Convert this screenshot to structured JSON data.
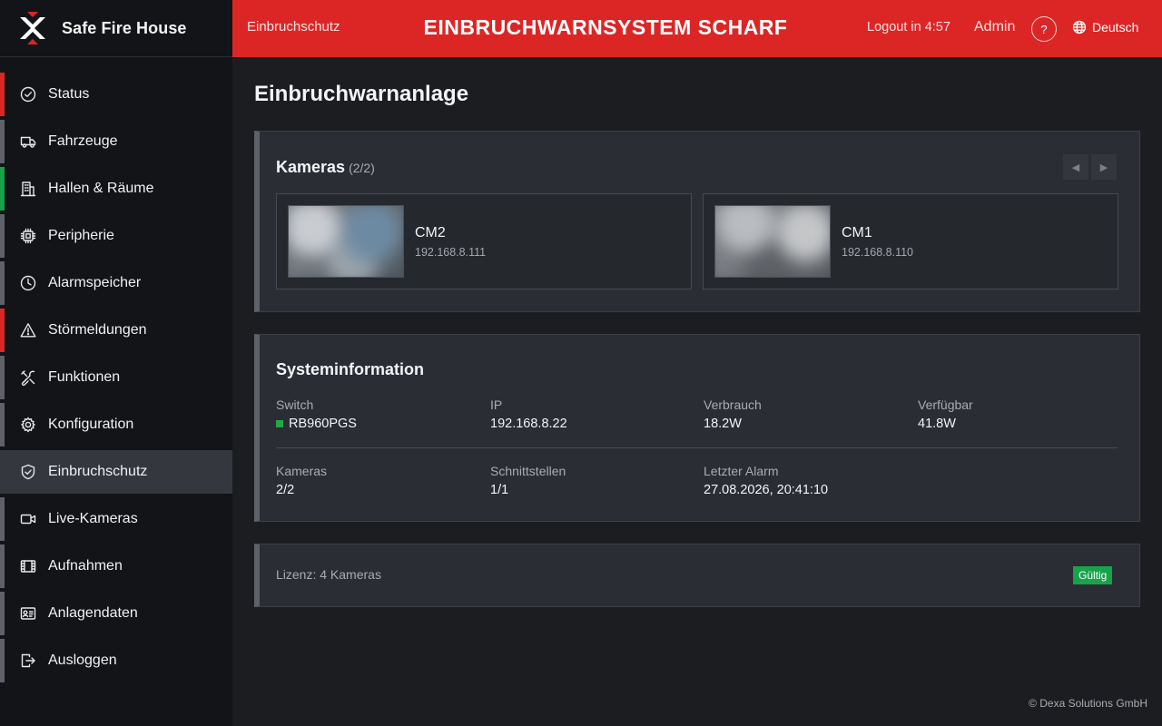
{
  "app": {
    "name": "Safe Fire House"
  },
  "header": {
    "breadcrumb": "Einbruchschutz",
    "status_title": "EINBRUCHWARNSYSTEM SCHARF",
    "logout_text": "Logout in 4:57",
    "user": "Admin",
    "help": "?",
    "language": "Deutsch",
    "background_color": "#dc2626"
  },
  "sidebar": {
    "items": [
      {
        "label": "Status",
        "icon": "check-circle-icon",
        "indicator": "#dc2626"
      },
      {
        "label": "Fahrzeuge",
        "icon": "truck-icon",
        "indicator": "#5e6168"
      },
      {
        "label": "Hallen & Räume",
        "icon": "building-icon",
        "indicator": "#16a34a"
      },
      {
        "label": "Peripherie",
        "icon": "chip-icon",
        "indicator": "#5e6168"
      },
      {
        "label": "Alarmspeicher",
        "icon": "clock-icon",
        "indicator": "#5e6168"
      },
      {
        "label": "Störmeldungen",
        "icon": "warning-icon",
        "indicator": "#dc2626"
      },
      {
        "label": "Funktionen",
        "icon": "tools-icon",
        "indicator": "#5e6168"
      },
      {
        "label": "Konfiguration",
        "icon": "gear-icon",
        "indicator": "#5e6168"
      },
      {
        "label": "Einbruchschutz",
        "icon": "shield-icon",
        "indicator": "#34373d",
        "active": true
      },
      {
        "label": "Live-Kameras",
        "icon": "video-icon",
        "indicator": "#5e6168"
      },
      {
        "label": "Aufnahmen",
        "icon": "film-icon",
        "indicator": "#5e6168"
      },
      {
        "label": "Anlagendaten",
        "icon": "id-card-icon",
        "indicator": "#5e6168"
      },
      {
        "label": "Ausloggen",
        "icon": "logout-icon",
        "indicator": "#5e6168"
      }
    ]
  },
  "main": {
    "title": "Einbruchwarnanlage",
    "cameras": {
      "title": "Kameras",
      "count": "(2/2)",
      "items": [
        {
          "name": "CM2",
          "ip": "192.168.8.111"
        },
        {
          "name": "CM1",
          "ip": "192.168.8.110"
        }
      ]
    },
    "system": {
      "title": "Systeminformation",
      "switch_label": "Switch",
      "switch_value": "RB960PGS",
      "switch_status_color": "#22a84a",
      "ip_label": "IP",
      "ip_value": "192.168.8.22",
      "consumption_label": "Verbrauch",
      "consumption_value": "18.2W",
      "available_label": "Verfügbar",
      "available_value": "41.8W",
      "cameras_label": "Kameras",
      "cameras_value": "2/2",
      "interfaces_label": "Schnittstellen",
      "interfaces_value": "1/1",
      "last_alarm_label": "Letzter Alarm",
      "last_alarm_value": "27.08.2026, 20:41:10"
    },
    "license": {
      "text": "Lizenz: 4 Kameras",
      "badge": "Gültig",
      "badge_color": "#16a34a"
    }
  },
  "footer": {
    "copyright": "© Dexa Solutions GmbH"
  }
}
